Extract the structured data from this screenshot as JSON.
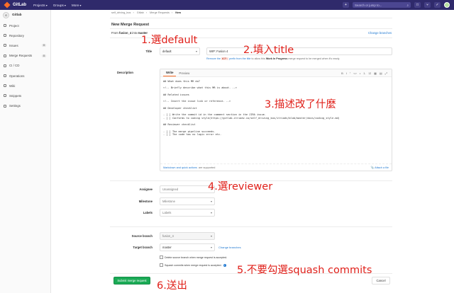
{
  "nav": {
    "brand": "GitLab",
    "links": [
      "Projects",
      "Groups",
      "More"
    ],
    "search_placeholder": "Search or jump to..."
  },
  "sidebar": {
    "project_initial": "G",
    "project_name": "Gitlab",
    "items": [
      {
        "label": "Project",
        "count": ""
      },
      {
        "label": "Repository",
        "count": ""
      },
      {
        "label": "Issues",
        "count": "0"
      },
      {
        "label": "Merge Requests",
        "count": "0"
      },
      {
        "label": "CI / CD",
        "count": ""
      },
      {
        "label": "Operations",
        "count": ""
      },
      {
        "label": "Wiki",
        "count": ""
      },
      {
        "label": "Snippets",
        "count": ""
      },
      {
        "label": "Settings",
        "count": ""
      }
    ]
  },
  "breadcrumb": [
    "self_driving_bus",
    "Gitlab",
    "Merge Requests",
    "New"
  ],
  "page": {
    "title": "New Merge Request",
    "from_prefix": "From",
    "from_branch": "fusion_4",
    "into_word": "into",
    "into_branch": "master",
    "change_branches": "Change branches"
  },
  "title_field": {
    "label": "Title",
    "template": "default",
    "value": "WIP: Fusion 4",
    "help_prefix": "Remove the",
    "help_code": "WIP:",
    "help_middle": "prefix from the title",
    "help_suffix": "to allow this",
    "help_bold": "Work In Progress",
    "help_end": "merge request to be merged when it's ready."
  },
  "description": {
    "label": "Description",
    "tab_write": "Write",
    "tab_preview": "Preview",
    "tools": [
      "B",
      "I",
      "”",
      "<>",
      "•",
      "1.",
      "☑",
      "▦",
      "▤",
      "⤢"
    ],
    "text": "## What does this MR do?\n\n<!-- Briefly describe what this MR is about. -->\n\n## Related issues\n\n<!-- Insert the issue link or reference. -->\n\n## Developer checklist\n\n- [ ] Write the commit id in the comment section in the JIRA issue.\n- [ ] Conforms to coding style(https://gitlab.itriadv.co/self_driving_bus/itriadv/blob/master/docs/coding_style.md)\n\n## Reviewer checklist\n\n- [ ] The merge pipeline succeeds.\n- [ ] The code has no logic error etc.",
    "foot_link": "Markdown and quick actions",
    "foot_suffix": "are supported",
    "attach": "Attach a file"
  },
  "meta": {
    "assignee_label": "Assignee",
    "assignee_value": "Unassigned",
    "milestone_label": "Milestone",
    "milestone_value": "Milestone",
    "labels_label": "Labels",
    "labels_value": "Labels"
  },
  "branches": {
    "source_label": "Source branch",
    "source_value": "fusion_4",
    "target_label": "Target branch",
    "target_value": "master",
    "change_branches": "Change branches"
  },
  "options": {
    "delete_source": "Delete source branch when merge request is accepted.",
    "squash": "Squash commits when merge request is accepted."
  },
  "actions": {
    "submit": "Submit merge request",
    "cancel": "Cancel"
  },
  "annotations": {
    "a1": "1.選default",
    "a2": "2.填入title",
    "a3": "3.描述改了什麼",
    "a4": "4.選reviewer",
    "a5": "5.不要勾選squash commits",
    "a6": "6.送出"
  },
  "colors": {
    "nav": "#2f2a6b",
    "accent": "#fc6d26",
    "link": "#1f78d1",
    "submit": "#1aaa55",
    "annotation": "#e0201a"
  }
}
